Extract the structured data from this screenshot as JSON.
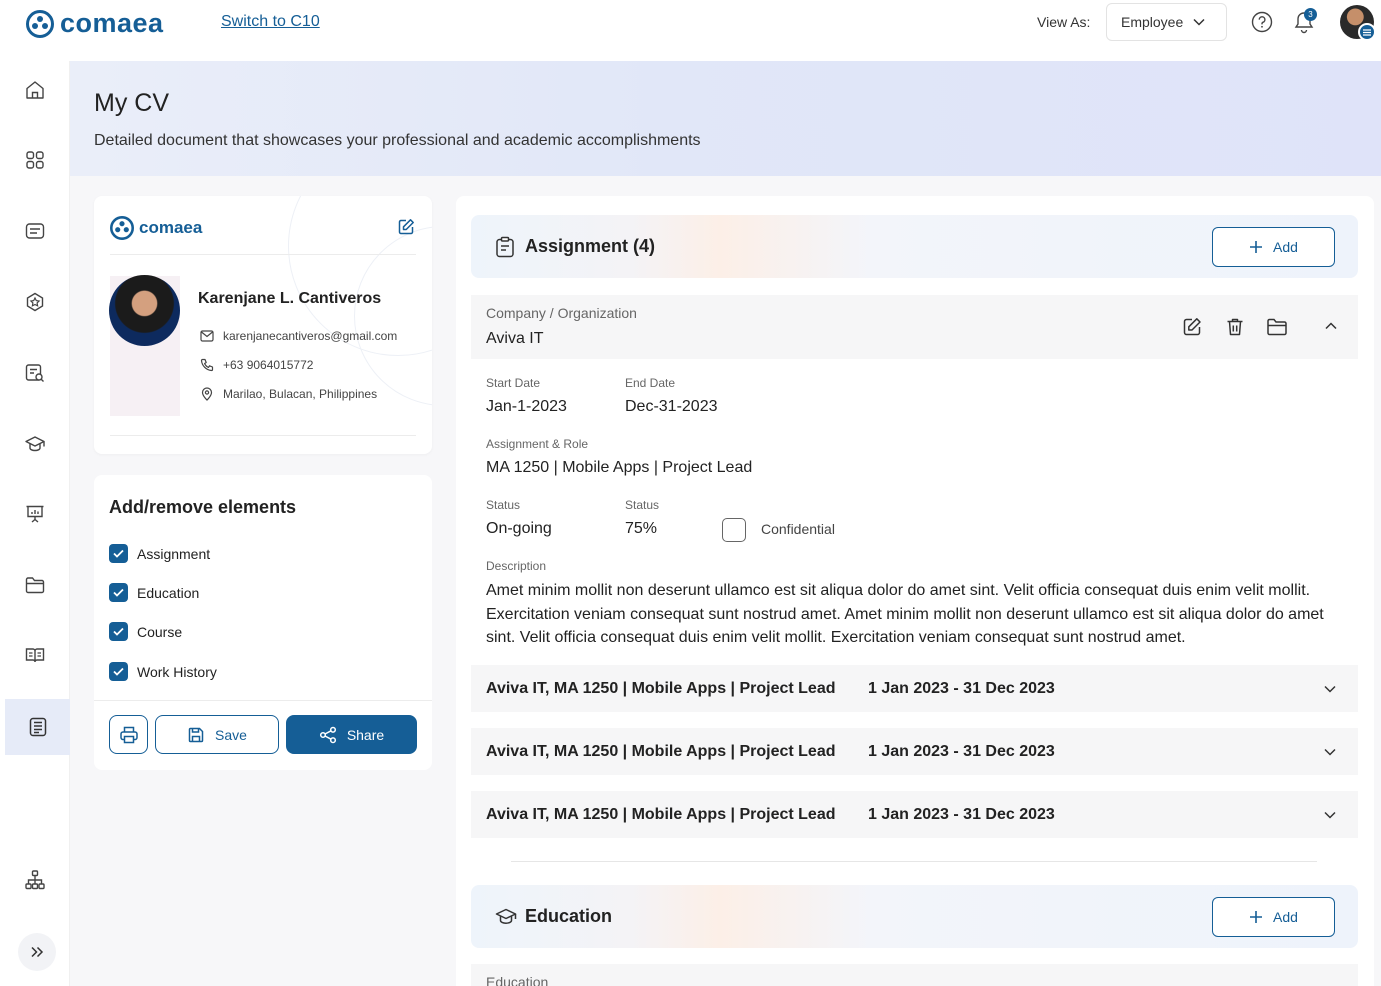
{
  "header": {
    "brand": "comaea",
    "switch_link": "Switch to C10",
    "view_as_label": "View As:",
    "view_as_value": "Employee",
    "notification_count": "3"
  },
  "hero": {
    "title": "My CV",
    "subtitle": "Detailed document that showcases your professional and academic accomplishments"
  },
  "profile": {
    "brand": "comaea",
    "name": "Karenjane L. Cantiveros",
    "email": "karenjanecantiveros@gmail.com",
    "phone": "+63 9064015772",
    "location": "Marilao, Bulacan, Philippines"
  },
  "elements": {
    "title": "Add/remove elements",
    "items": [
      {
        "label": "Assignment",
        "checked": true
      },
      {
        "label": "Education",
        "checked": true
      },
      {
        "label": "Course",
        "checked": true
      },
      {
        "label": "Work History",
        "checked": true
      }
    ],
    "save_label": "Save",
    "share_label": "Share"
  },
  "assignment": {
    "title": "Assignment (4)",
    "add_label": "Add",
    "company_label": "Company / Organization",
    "company_value": "Aviva IT",
    "start_label": "Start Date",
    "start_value": "Jan-1-2023",
    "end_label": "End Date",
    "end_value": "Dec-31-2023",
    "role_label": "Assignment & Role",
    "role_value": "MA 1250 | Mobile Apps | Project Lead",
    "status_label": "Status",
    "status_value": "On-going",
    "progress_label": "Status",
    "progress_value": "75%",
    "confidential_label": "Confidential",
    "description_label": "Description",
    "description": "Amet minim mollit non deserunt ullamco est sit aliqua dolor do amet sint. Velit officia consequat duis enim velit mollit. Exercitation veniam consequat sunt nostrud amet. Amet minim mollit non deserunt ullamco est sit aliqua dolor do amet sint. Velit officia consequat duis enim velit mollit. Exercitation veniam consequat sunt nostrud amet.",
    "collapsed": [
      {
        "title": "Aviva IT, MA 1250 | Mobile Apps | Project Lead",
        "dates": "1 Jan 2023 - 31 Dec 2023"
      },
      {
        "title": "Aviva IT, MA 1250 | Mobile Apps | Project Lead",
        "dates": "1 Jan 2023 - 31 Dec 2023"
      },
      {
        "title": "Aviva IT, MA 1250 | Mobile Apps | Project Lead",
        "dates": "1 Jan 2023 - 31 Dec 2023"
      }
    ]
  },
  "education": {
    "title": "Education",
    "add_label": "Add",
    "field_label": "Education"
  },
  "colors": {
    "brand": "#155e96",
    "hero_bg": "#e1e7f8",
    "sidebar_active": "#e6ebf8"
  }
}
